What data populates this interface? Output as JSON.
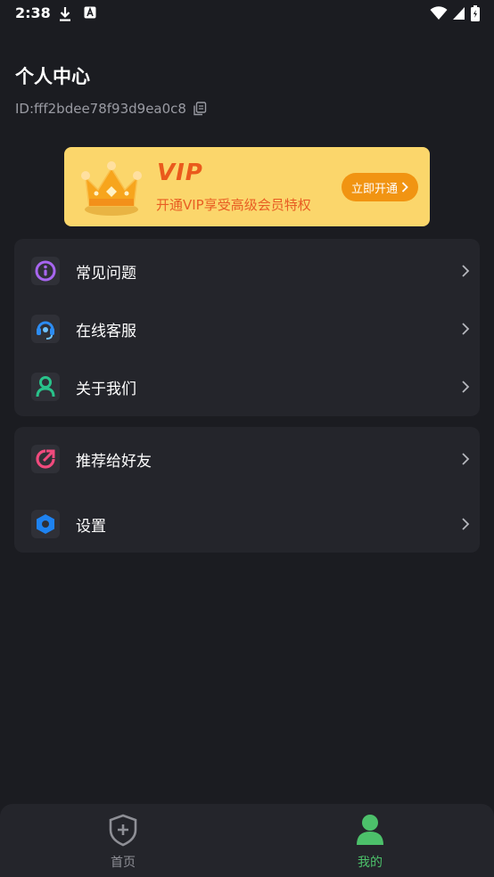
{
  "status_bar": {
    "time": "2:38"
  },
  "header": {
    "title": "个人中心",
    "user_id": "ID:fff2bdee78f93d9ea0c8"
  },
  "vip_banner": {
    "badge": "VIP",
    "description": "开通VIP享受高级会员特权",
    "button_label": "立即开通"
  },
  "menu_groups": [
    {
      "items": [
        {
          "label": "常见问题",
          "icon": "help-info-icon"
        },
        {
          "label": "在线客服",
          "icon": "headset-icon"
        },
        {
          "label": "关于我们",
          "icon": "person-icon"
        }
      ]
    },
    {
      "items": [
        {
          "label": "推荐给好友",
          "icon": "share-icon"
        },
        {
          "label": "设置",
          "icon": "settings-hexagon-icon"
        }
      ]
    }
  ],
  "bottom_nav": {
    "items": [
      {
        "label": "首页",
        "icon": "shield-plus-icon",
        "active": false
      },
      {
        "label": "我的",
        "icon": "user-icon",
        "active": true
      }
    ]
  },
  "colors": {
    "background": "#1b1c21",
    "card": "#24252b",
    "vip_yellow": "#fbd66b",
    "vip_orange": "#f19412",
    "active_green": "#4cc06a"
  }
}
